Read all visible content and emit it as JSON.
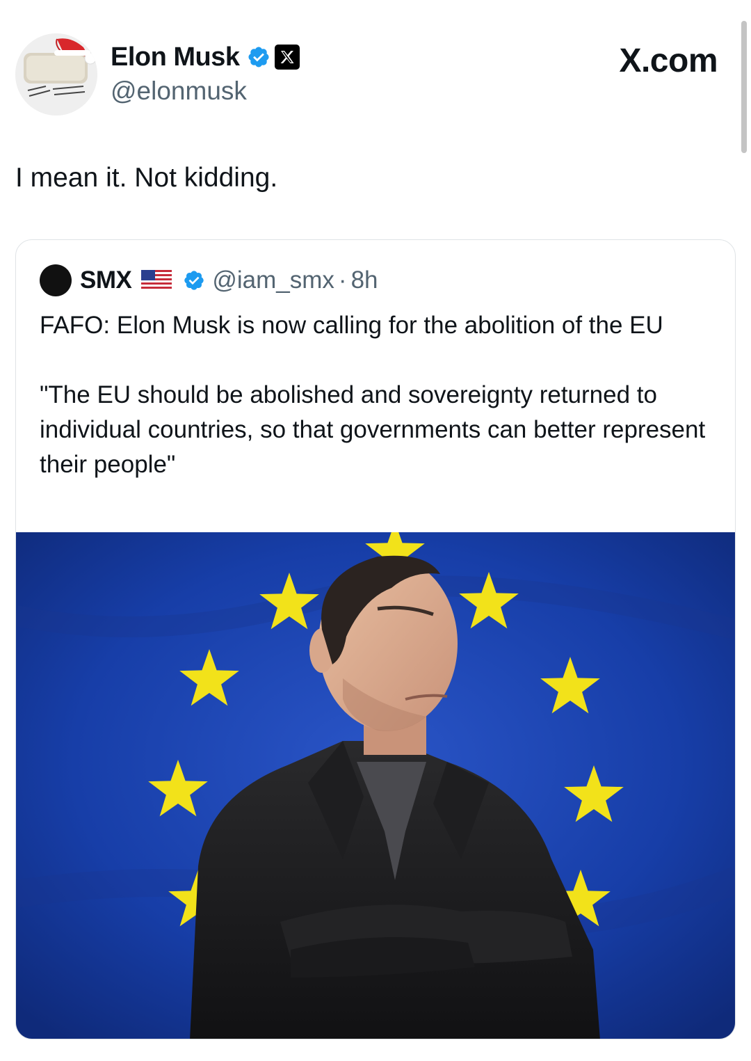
{
  "post": {
    "author_name": "Elon Musk",
    "author_handle": "@elonmusk",
    "site_label": "X.com",
    "text": "I mean it. Not kidding."
  },
  "quoted_post": {
    "author_name": "SMX",
    "author_handle": "@iam_smx",
    "separator": "·",
    "time": "8h",
    "text_line1": "FAFO: Elon Musk is now calling for the abolition of the EU",
    "text_line2": "\"The EU should be abolished and sovereignty returned to individual countries, so that governments can better represent their people\""
  },
  "icons": {
    "verified": "verified-badge-icon",
    "x_badge": "x-logo-icon",
    "flag": "us-flag-icon"
  },
  "colors": {
    "verified_blue": "#1d9bf0",
    "eu_blue": "#173ea8",
    "eu_star_yellow": "#f2e21a",
    "handle_gray": "#536471"
  }
}
